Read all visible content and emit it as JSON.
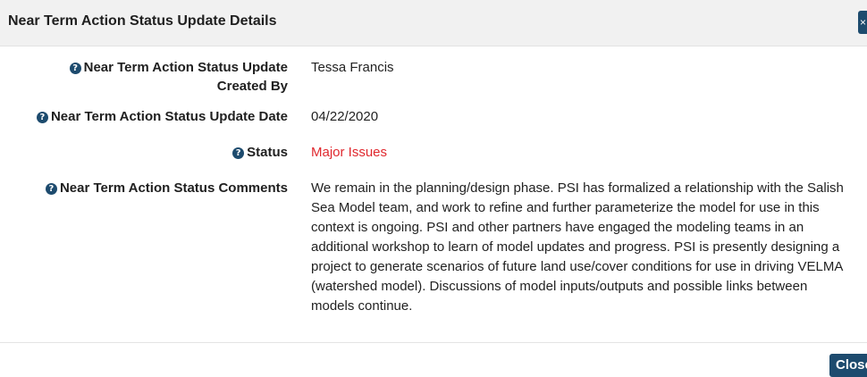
{
  "modal": {
    "title": "Near Term Action Status Update Details",
    "header_close_label": "×",
    "footer_close_label": "Close"
  },
  "icons": {
    "help": "question-circle-icon",
    "help_glyph": "?"
  },
  "colors": {
    "header_background": "#f1f1f1",
    "button_background": "#1d4b6e",
    "status_major_issues": "#e0282e"
  },
  "fields": {
    "created_by": {
      "label": "Near Term Action Status Update Created By",
      "value": "Tessa Francis"
    },
    "update_date": {
      "label": "Near Term Action Status Update Date",
      "value": "04/22/2020"
    },
    "status": {
      "label": "Status",
      "value": "Major Issues"
    },
    "comments": {
      "label": "Near Term Action Status Comments",
      "value": "We remain in the planning/design phase. PSI has formalized a relationship with the Salish Sea Model team, and work to refine and further parameterize the model for use in this context is ongoing. PSI and other partners have engaged the modeling teams in an additional workshop to learn of model updates and progress. PSI is presently designing a project to generate scenarios of future land use/cover conditions for use in driving VELMA (watershed model). Discussions of model inputs/outputs and possible links between models continue."
    }
  }
}
